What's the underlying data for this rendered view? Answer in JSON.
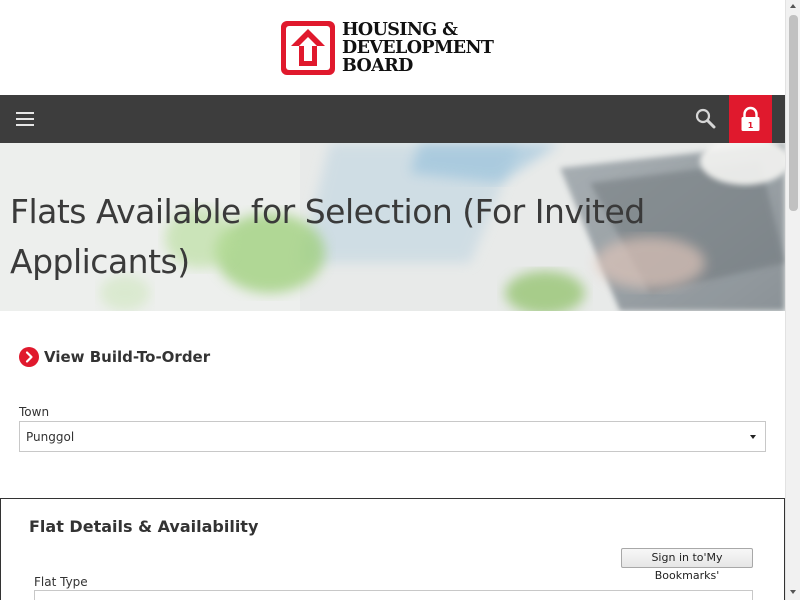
{
  "header": {
    "logo_lines": [
      "HOUSING &",
      "DEVELOPMENT",
      "BOARD"
    ],
    "logo_icon": "hdb-house-arrow-logo"
  },
  "navbar": {
    "menu_icon": "hamburger-menu-icon",
    "search_icon": "search-icon",
    "lock_icon": "lock-icon",
    "lock_badge": "1"
  },
  "hero": {
    "title_line1": "Flats Available for Selection (For Invited",
    "title_line2": "Applicants)"
  },
  "main": {
    "view_link_label": "View Build-To-Order",
    "town_label": "Town",
    "town_value": "Punggol"
  },
  "panel": {
    "title": "Flat Details & Availability",
    "bookmark_button": "Sign in to'My Bookmarks'",
    "flat_type_label": "Flat Type",
    "flat_type_value": ""
  },
  "colors": {
    "brand_red": "#e0192d",
    "navbar": "#3d3d3d",
    "text": "#333333"
  }
}
